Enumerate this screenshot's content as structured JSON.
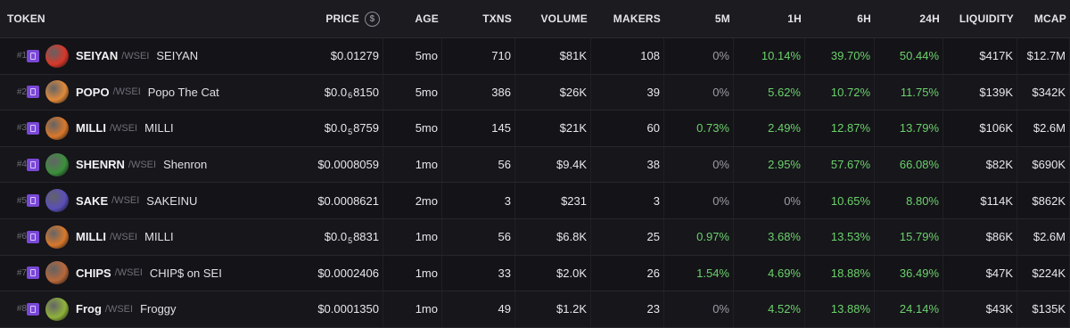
{
  "header": {
    "token": "TOKEN",
    "price": "PRICE",
    "price_icon": "$",
    "age": "AGE",
    "txns": "TXNS",
    "volume": "VOLUME",
    "makers": "MAKERS",
    "m5": "5M",
    "h1": "1H",
    "h6": "6H",
    "h24": "24H",
    "liquidity": "LIQUIDITY",
    "mcap": "MCAP"
  },
  "rows": [
    {
      "rank": "#1",
      "symbol": "SEIYAN",
      "quote": "/WSEI",
      "name": "SEIYAN",
      "price": "$0.01279",
      "age": "5mo",
      "txns": "710",
      "volume": "$81K",
      "makers": "108",
      "m5": "0%",
      "h1": "10.14%",
      "h6": "39.70%",
      "h24": "50.44%",
      "liquidity": "$417K",
      "mcap": "$12.7M",
      "avatar_color": "#d8382a"
    },
    {
      "rank": "#2",
      "symbol": "POPO",
      "quote": "/WSEI",
      "name": "Popo The Cat",
      "price_pre": "$0.0",
      "price_sub": "6",
      "price_post": "8150",
      "age": "5mo",
      "txns": "386",
      "volume": "$26K",
      "makers": "39",
      "m5": "0%",
      "h1": "5.62%",
      "h6": "10.72%",
      "h24": "11.75%",
      "liquidity": "$139K",
      "mcap": "$342K",
      "avatar_color": "#e08a3a"
    },
    {
      "rank": "#3",
      "symbol": "MILLI",
      "quote": "/WSEI",
      "name": "MILLI",
      "price_pre": "$0.0",
      "price_sub": "5",
      "price_post": "8759",
      "age": "5mo",
      "txns": "145",
      "volume": "$21K",
      "makers": "60",
      "m5": "0.73%",
      "h1": "2.49%",
      "h6": "12.87%",
      "h24": "13.79%",
      "liquidity": "$106K",
      "mcap": "$2.6M",
      "avatar_color": "#d9782b"
    },
    {
      "rank": "#4",
      "symbol": "SHENRN",
      "quote": "/WSEI",
      "name": "Shenron",
      "price": "$0.0008059",
      "age": "1mo",
      "txns": "56",
      "volume": "$9.4K",
      "makers": "38",
      "m5": "0%",
      "h1": "2.95%",
      "h6": "57.67%",
      "h24": "66.08%",
      "liquidity": "$82K",
      "mcap": "$690K",
      "avatar_color": "#3c8f3c"
    },
    {
      "rank": "#5",
      "symbol": "SAKE",
      "quote": "/WSEI",
      "name": "SAKEINU",
      "price": "$0.0008621",
      "age": "2mo",
      "txns": "3",
      "volume": "$231",
      "makers": "3",
      "m5": "0%",
      "h1": "0%",
      "h6": "10.65%",
      "h24": "8.80%",
      "liquidity": "$114K",
      "mcap": "$862K",
      "avatar_color": "#5a4fb8"
    },
    {
      "rank": "#6",
      "symbol": "MILLI",
      "quote": "/WSEI",
      "name": "MILLI",
      "price_pre": "$0.0",
      "price_sub": "5",
      "price_post": "8831",
      "age": "1mo",
      "txns": "56",
      "volume": "$6.8K",
      "makers": "25",
      "m5": "0.97%",
      "h1": "3.68%",
      "h6": "13.53%",
      "h24": "15.79%",
      "liquidity": "$86K",
      "mcap": "$2.6M",
      "avatar_color": "#d9782b"
    },
    {
      "rank": "#7",
      "symbol": "CHIPS",
      "quote": "/WSEI",
      "name": "CHIP$ on SEI",
      "price": "$0.0002406",
      "age": "1mo",
      "txns": "33",
      "volume": "$2.0K",
      "makers": "26",
      "m5": "1.54%",
      "h1": "4.69%",
      "h6": "18.88%",
      "h24": "36.49%",
      "liquidity": "$47K",
      "mcap": "$224K",
      "avatar_color": "#b8683a"
    },
    {
      "rank": "#8",
      "symbol": "Frog",
      "quote": "/WSEI",
      "name": "Froggy",
      "price": "$0.0001350",
      "age": "1mo",
      "txns": "49",
      "volume": "$1.2K",
      "makers": "23",
      "m5": "0%",
      "h1": "4.52%",
      "h6": "13.88%",
      "h24": "24.14%",
      "liquidity": "$43K",
      "mcap": "$135K",
      "avatar_color": "#8fb23a"
    }
  ],
  "colors": {
    "positive": "#6cd16b",
    "neutral": "#9c9ca5",
    "chain_badge": "#7a48d6"
  }
}
